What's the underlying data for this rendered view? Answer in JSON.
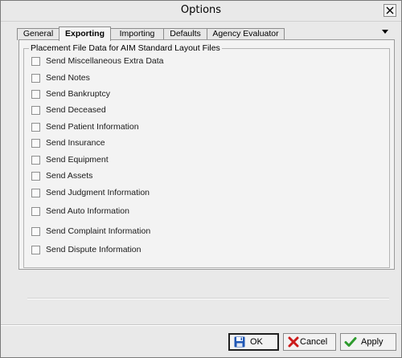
{
  "window": {
    "title": "Options"
  },
  "tabs": [
    {
      "label": "General",
      "active": false
    },
    {
      "label": "Exporting",
      "active": true
    },
    {
      "label": "Importing",
      "active": false
    },
    {
      "label": "Defaults",
      "active": false
    },
    {
      "label": "Agency Evaluator",
      "active": false
    }
  ],
  "group": {
    "title": "Placement File Data for AIM Standard Layout Files",
    "options": [
      {
        "label": "Send Miscellaneous Extra Data",
        "checked": false
      },
      {
        "label": "Send Notes",
        "checked": false
      },
      {
        "label": "Send Bankruptcy",
        "checked": false
      },
      {
        "label": "Send Deceased",
        "checked": false
      },
      {
        "label": "Send Patient Information",
        "checked": false
      },
      {
        "label": "Send Insurance",
        "checked": false
      },
      {
        "label": "Send Equipment",
        "checked": false
      },
      {
        "label": "Send Assets",
        "checked": false
      },
      {
        "label": "Send Judgment Information",
        "checked": false
      },
      {
        "label": "Send Auto Information",
        "checked": false
      },
      {
        "label": "Send Complaint Information",
        "checked": false
      },
      {
        "label": "Send Dispute Information",
        "checked": false
      }
    ]
  },
  "buttons": {
    "ok": "OK",
    "cancel": "Cancel",
    "apply": "Apply"
  },
  "icons": {
    "ok": "floppy-disk-icon",
    "cancel": "red-x-icon",
    "apply": "green-check-icon",
    "close": "close-icon",
    "tab_overflow": "chevron-down-icon"
  },
  "colors": {
    "ok_icon": "#1f57b5",
    "cancel_icon": "#cc1b1b",
    "apply_icon": "#2e9b2e"
  }
}
